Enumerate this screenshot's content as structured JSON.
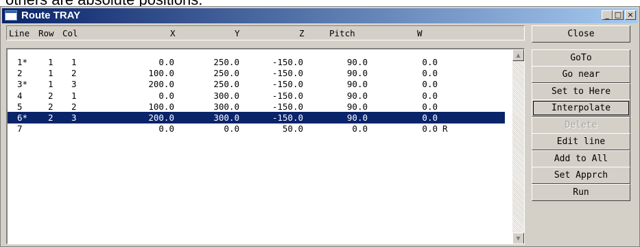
{
  "caption": "others are absolute positions.",
  "window": {
    "title": "Route TRAY",
    "minimize": "_",
    "maximize": "□",
    "close": "×"
  },
  "columns": [
    "Line",
    "Row",
    "Col",
    "X",
    "Y",
    "Z",
    "Pitch",
    "W"
  ],
  "rows": [
    {
      "line": "1*",
      "row": "1",
      "col": "1",
      "x": "0.0",
      "y": "250.0",
      "z": "-150.0",
      "pitch": "90.0",
      "w": "0.0",
      "flag": ""
    },
    {
      "line": "2",
      "row": "1",
      "col": "2",
      "x": "100.0",
      "y": "250.0",
      "z": "-150.0",
      "pitch": "90.0",
      "w": "0.0",
      "flag": ""
    },
    {
      "line": "3*",
      "row": "1",
      "col": "3",
      "x": "200.0",
      "y": "250.0",
      "z": "-150.0",
      "pitch": "90.0",
      "w": "0.0",
      "flag": ""
    },
    {
      "line": "4",
      "row": "2",
      "col": "1",
      "x": "0.0",
      "y": "300.0",
      "z": "-150.0",
      "pitch": "90.0",
      "w": "0.0",
      "flag": ""
    },
    {
      "line": "5",
      "row": "2",
      "col": "2",
      "x": "100.0",
      "y": "300.0",
      "z": "-150.0",
      "pitch": "90.0",
      "w": "0.0",
      "flag": ""
    },
    {
      "line": "6*",
      "row": "2",
      "col": "3",
      "x": "200.0",
      "y": "300.0",
      "z": "-150.0",
      "pitch": "90.0",
      "w": "0.0",
      "flag": ""
    },
    {
      "line": "7",
      "row": "",
      "col": "",
      "x": "0.0",
      "y": "0.0",
      "z": "50.0",
      "pitch": "0.0",
      "w": "0.0",
      "flag": "R"
    }
  ],
  "selected_line": "6*",
  "buttons": {
    "close": "Close",
    "goto": "GoTo",
    "go_near": "Go near",
    "set_to_here": "Set to Here",
    "interpolate": "Interpolate",
    "delete": "Delete",
    "edit_line": "Edit line",
    "add_to_all": "Add to All",
    "set_apprch": "Set Apprch",
    "run": "Run"
  },
  "colors": {
    "selection": "#0a246a",
    "title_bar": "#0a246a",
    "face": "#d4d0c8"
  }
}
